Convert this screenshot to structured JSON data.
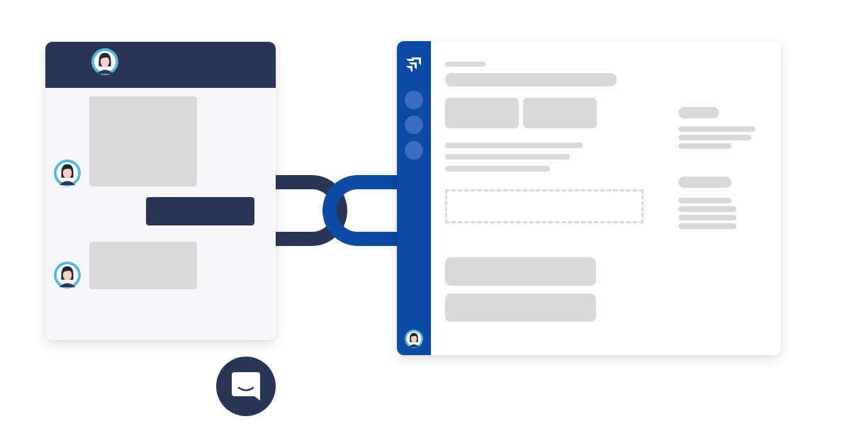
{
  "colors": {
    "navy": "#2b3657",
    "brand_blue": "#0b4aa5",
    "placeholder_gray": "#d9d9d9",
    "avatar_ring": "#56b9dc"
  },
  "icons": {
    "chat_header_avatar": "user-avatar-icon",
    "app_logo": "jira-logo-icon",
    "messenger_launcher": "chat-bubble-smile-icon",
    "link": "chain-link-icon"
  }
}
